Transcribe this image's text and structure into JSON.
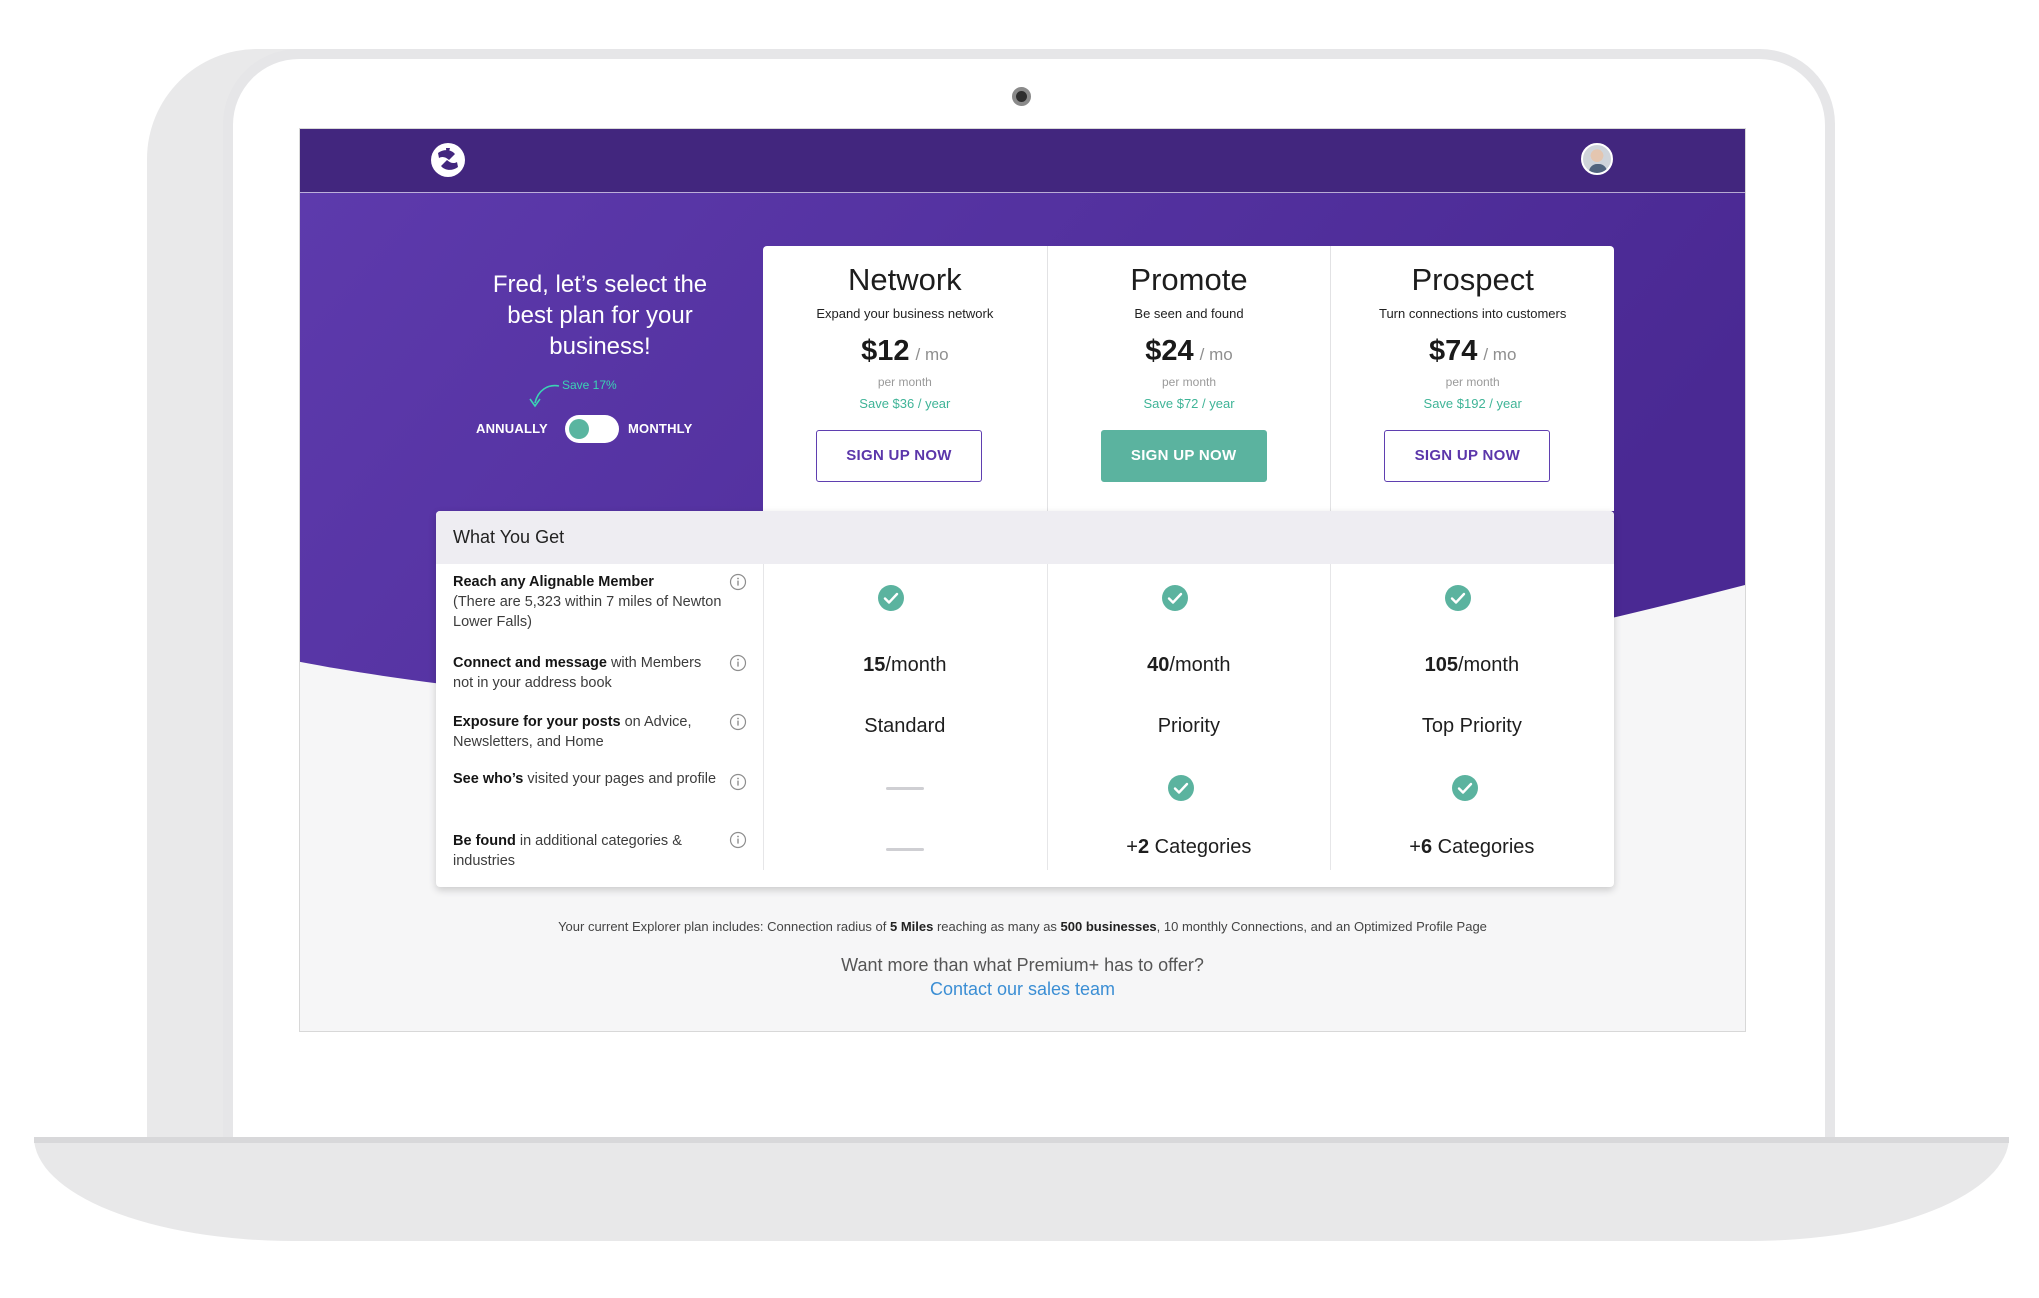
{
  "intro": {
    "line1": "Fred, let’s select the",
    "line2": "best plan for your",
    "line3": "business!"
  },
  "billing_toggle": {
    "save_note": "Save 17%",
    "annually_label": "ANNUALLY",
    "monthly_label": "MONTHLY",
    "selected": "ANNUALLY"
  },
  "plans": [
    {
      "name": "Network",
      "tagline": "Expand your business network",
      "price": "$12",
      "unit": "/ mo",
      "per": "per month",
      "save": "Save $36 / year",
      "button": "SIGN UP NOW",
      "button_style": "outline"
    },
    {
      "name": "Promote",
      "tagline": "Be seen and found",
      "price": "$24",
      "unit": "/ mo",
      "per": "per month",
      "save": "Save $72 / year",
      "button": "SIGN UP NOW",
      "button_style": "filled"
    },
    {
      "name": "Prospect",
      "tagline": "Turn connections into customers",
      "price": "$74",
      "unit": "/ mo",
      "per": "per month",
      "save": "Save $192 / year",
      "button": "SIGN UP NOW",
      "button_style": "outline"
    }
  ],
  "table": {
    "title": "What You Get",
    "features": [
      {
        "bold": "Reach any Alignable Member",
        "rest": "(There are 5,323 within 7 miles of Newton Lower Falls)"
      },
      {
        "bold": "Connect and message",
        "rest": " with Members not in your address book"
      },
      {
        "bold": "Exposure for your posts",
        "rest": " on Advice, Newsletters, and Home"
      },
      {
        "bold": "See who’s",
        "rest": " visited your pages and profile"
      },
      {
        "bold": "Be found",
        "rest": " in additional categories & industries"
      }
    ],
    "values": {
      "connect": [
        {
          "num": "15",
          "suffix": "/month"
        },
        {
          "num": "40",
          "suffix": "/month"
        },
        {
          "num": "105",
          "suffix": "/month"
        }
      ],
      "exposure": [
        "Standard",
        "Priority",
        "Top Priority"
      ],
      "found": [
        {
          "prefix": "",
          "num": "",
          "suffix": ""
        },
        {
          "prefix": "+",
          "num": "2",
          "suffix": " Categories"
        },
        {
          "prefix": "+",
          "num": "6",
          "suffix": " Categories"
        }
      ]
    }
  },
  "footer": {
    "note_start": "Your current Explorer plan includes: Connection radius of ",
    "note_b1": "5 Miles",
    "note_mid1": " reaching as many as ",
    "note_b2": "500 businesses",
    "note_end": ", 10 monthly Connections, and an Optimized Profile Page",
    "more": "Want more than what Premium+ has to offer?",
    "contact": "Contact our sales team"
  },
  "colors": {
    "header": "#42267e",
    "hero_purple": "#5a37a8",
    "accent_green": "#5bb39f",
    "link_blue": "#3b8ed4",
    "button_purple": "#5b36aa"
  },
  "icons": {
    "logo": "alignable-logo-icon",
    "info": "info-icon",
    "check": "check-circle-icon",
    "avatar": "user-avatar"
  }
}
